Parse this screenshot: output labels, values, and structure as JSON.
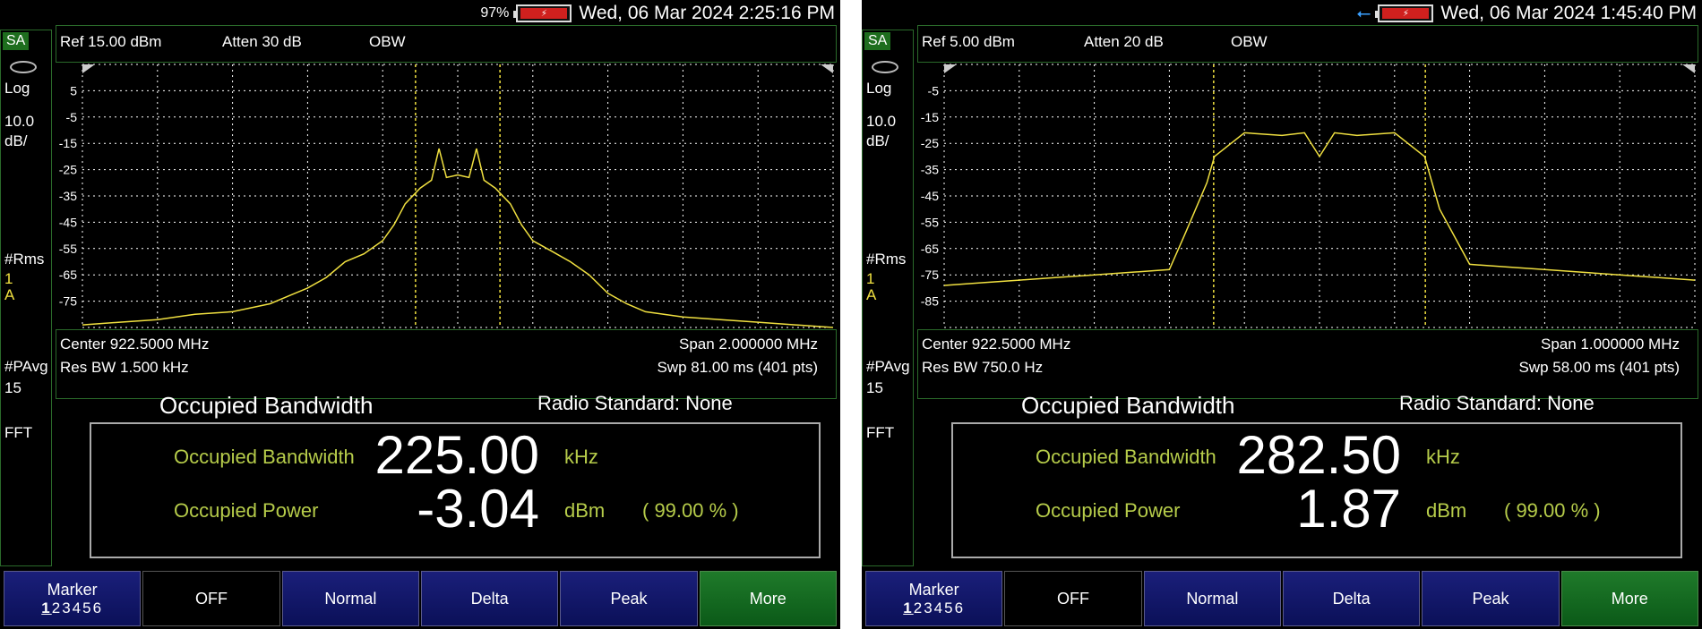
{
  "colors": {
    "trace": "#f0e040",
    "grid": "#ffffff",
    "result_label": "#b6cc4a",
    "softkey_blue": "#1a1f7a",
    "softkey_green": "#1f7a2a"
  },
  "panels": [
    {
      "status": {
        "battery": "97%",
        "datetime": "Wed, 06 Mar 2024 2:25:16 PM",
        "icons": [
          "battery-icon"
        ]
      },
      "mode": "SA",
      "scale": {
        "type": "Log",
        "div": "10.0",
        "unit": "dB/"
      },
      "trace_info": {
        "rms": "#Rms",
        "num": "1",
        "letter": "A"
      },
      "pavg": {
        "label": "#PAvg",
        "count": "15"
      },
      "fft": "FFT",
      "header": {
        "ref": "Ref 15.00 dBm",
        "atten": "Atten 30 dB",
        "meas": "OBW"
      },
      "footer": {
        "center": "Center 922.5000 MHz",
        "span": "Span 2.000000 MHz",
        "rbw": "Res BW 1.500 kHz",
        "sweep": "Swp 81.00 ms (401 pts)"
      },
      "obw_title": "Occupied Bandwidth",
      "radio_standard": "Radio Standard: None",
      "results": {
        "bw_label": "Occupied Bandwidth",
        "bw_value": "225.00",
        "bw_unit": "kHz",
        "pwr_label": "Occupied Power",
        "pwr_value": "-3.04",
        "pwr_unit": "dBm",
        "pct": "( 99.00 % )"
      },
      "softkeys": {
        "marker": "Marker",
        "marker_nums": [
          "1",
          "2",
          "3",
          "4",
          "5",
          "6"
        ],
        "off": "OFF",
        "normal": "Normal",
        "delta": "Delta",
        "peak": "Peak",
        "more": "More"
      },
      "chart_data": {
        "type": "line",
        "ylabels": [
          "5",
          "-5",
          "-15",
          "-25",
          "-35",
          "-45",
          "-55",
          "-65",
          "-75"
        ],
        "ylim": [
          -85,
          15
        ],
        "xlim": [
          921.5,
          923.5
        ],
        "obw_markers": [
          922.3875,
          922.6125
        ],
        "series": [
          {
            "x": [
              921.5,
              921.6,
              921.7,
              921.8,
              921.9,
              922.0,
              922.05,
              922.1,
              922.15,
              922.2,
              922.25,
              922.3,
              922.33,
              922.36,
              922.4,
              922.43,
              922.45,
              922.47,
              922.5,
              922.53,
              922.55,
              922.57,
              922.6,
              922.64,
              922.67,
              922.7,
              922.75,
              922.8,
              922.85,
              922.9,
              922.95,
              923.0,
              923.1,
              923.2,
              923.3,
              923.4,
              923.5
            ],
            "values": [
              -84,
              -83,
              -82,
              -80,
              -79,
              -76,
              -73,
              -70,
              -66,
              -60,
              -57,
              -52,
              -46,
              -38,
              -32,
              -29,
              -17,
              -28,
              -27,
              -28,
              -17,
              -29,
              -32,
              -38,
              -46,
              -52,
              -56,
              -60,
              -65,
              -72,
              -76,
              -79,
              -81,
              -82,
              -83,
              -84,
              -85
            ]
          }
        ]
      }
    },
    {
      "status": {
        "datetime": "Wed, 06 Mar 2024 1:45:40 PM",
        "icons": [
          "usb-icon",
          "battery-icon"
        ]
      },
      "mode": "SA",
      "scale": {
        "type": "Log",
        "div": "10.0",
        "unit": "dB/"
      },
      "trace_info": {
        "rms": "#Rms",
        "num": "1",
        "letter": "A"
      },
      "pavg": {
        "label": "#PAvg",
        "count": "15"
      },
      "fft": "FFT",
      "header": {
        "ref": "Ref 5.00 dBm",
        "atten": "Atten 20 dB",
        "meas": "OBW"
      },
      "footer": {
        "center": "Center 922.5000 MHz",
        "span": "Span 1.000000 MHz",
        "rbw": "Res BW 750.0  Hz",
        "sweep": "Swp 58.00 ms (401 pts)"
      },
      "obw_title": "Occupied Bandwidth",
      "radio_standard": "Radio Standard: None",
      "results": {
        "bw_label": "Occupied Bandwidth",
        "bw_value": "282.50",
        "bw_unit": "kHz",
        "pwr_label": "Occupied Power",
        "pwr_value": "1.87",
        "pwr_unit": "dBm",
        "pct": "( 99.00 % )"
      },
      "softkeys": {
        "marker": "Marker",
        "marker_nums": [
          "1",
          "2",
          "3",
          "4",
          "5",
          "6"
        ],
        "off": "OFF",
        "normal": "Normal",
        "delta": "Delta",
        "peak": "Peak",
        "more": "More"
      },
      "chart_data": {
        "type": "line",
        "ylabels": [
          "-5",
          "-15",
          "-25",
          "-35",
          "-45",
          "-55",
          "-65",
          "-75",
          "-85"
        ],
        "ylim": [
          -95,
          5
        ],
        "xlim": [
          922.0,
          923.0
        ],
        "obw_markers": [
          922.359,
          922.641
        ],
        "series": [
          {
            "x": [
              922.0,
              922.05,
              922.1,
              922.15,
              922.2,
              922.25,
              922.3,
              922.32,
              922.35,
              922.36,
              922.4,
              922.45,
              922.48,
              922.5,
              922.52,
              922.55,
              922.6,
              922.64,
              922.66,
              922.7,
              922.75,
              922.8,
              922.85,
              922.9,
              922.95,
              923.0
            ],
            "values": [
              -79,
              -78,
              -77,
              -76,
              -75,
              -74,
              -73,
              -60,
              -40,
              -30,
              -21,
              -22,
              -21,
              -30,
              -21,
              -22,
              -21,
              -30,
              -50,
              -71,
              -72,
              -73,
              -74,
              -75,
              -76,
              -77
            ]
          }
        ]
      }
    }
  ]
}
